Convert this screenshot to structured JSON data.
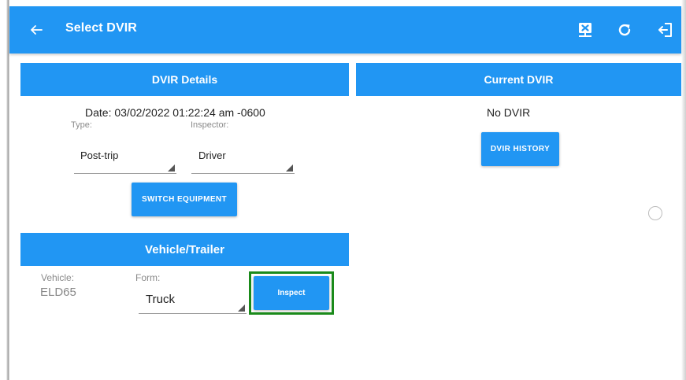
{
  "appbar": {
    "title": "Select DVIR",
    "back_icon": "arrow-left-icon",
    "actions": [
      "certify-icon",
      "refresh-icon",
      "logout-icon"
    ]
  },
  "dvir_details": {
    "header": "DVIR Details",
    "date_text": "Date: 03/02/2022 01:22:24 am -0600",
    "type_label": "Type:",
    "type_value": "Post-trip",
    "inspector_label": "Inspector:",
    "inspector_value": "Driver",
    "switch_equipment_label": "SWITCH EQUIPMENT"
  },
  "current_dvir": {
    "header": "Current DVIR",
    "status_text": "No DVIR",
    "history_button_label": "DVIR HISTORY"
  },
  "vehicle_trailer": {
    "header": "Vehicle/Trailer",
    "vehicle_label": "Vehicle:",
    "vehicle_value": "ELD65",
    "form_label": "Form:",
    "form_value": "Truck",
    "inspect_button_label": "Inspect"
  },
  "colors": {
    "primary": "#2196F3",
    "highlight": "#1a8a1a"
  }
}
